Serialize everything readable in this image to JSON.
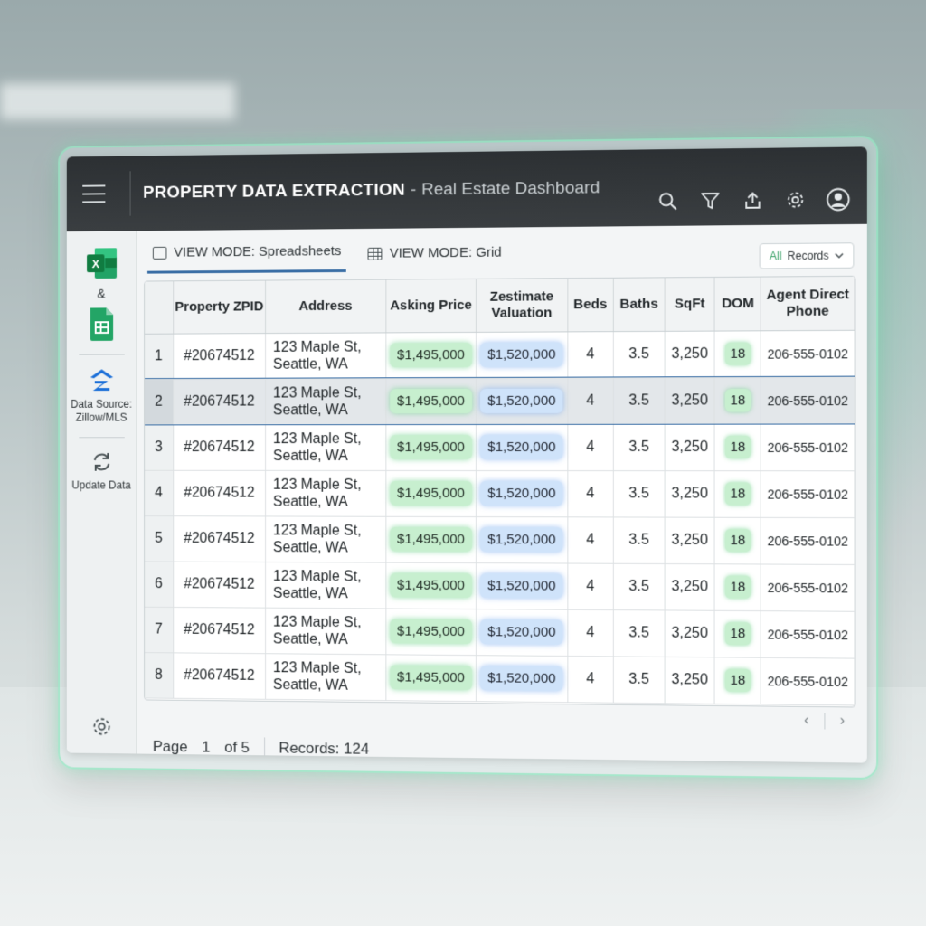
{
  "window": {
    "title_main": "PROPERTY DATA EXTRACTION",
    "title_dash": "-",
    "title_sub": "Real Estate Dashboard"
  },
  "toolbar_icons": [
    "search-icon",
    "filter-icon",
    "share-icon",
    "settings-icon",
    "profile-icon"
  ],
  "sidebar": {
    "ampersand": "&",
    "data_source_label": "Data Source: Zillow/MLS",
    "update_label": "Update Data"
  },
  "tabs": [
    {
      "label": "VIEW MODE: Spreadsheets",
      "active": true
    },
    {
      "label": "VIEW MODE: Grid",
      "active": false
    }
  ],
  "filter": {
    "all": "All",
    "label": "Records"
  },
  "table": {
    "headers": {
      "zpid": "Property ZPID",
      "address": "Address",
      "asking": "Asking Price",
      "zestimate": "Zestimate Valuation",
      "beds": "Beds",
      "baths": "Baths",
      "sqft": "SqFt",
      "dom": "DOM",
      "phone": "Agent Direct Phone"
    },
    "rows": [
      {
        "n": "1",
        "zpid": "#20674512",
        "addr1": "123 Maple St,",
        "addr2": "Seattle, WA",
        "asking": "$1,495,000",
        "zestimate": "$1,520,000",
        "beds": "4",
        "baths": "3.5",
        "sqft": "3,250",
        "dom": "18",
        "phone": "206-555-0102"
      },
      {
        "n": "2",
        "zpid": "#20674512",
        "addr1": "123 Maple St,",
        "addr2": "Seattle, WA",
        "asking": "$1,495,000",
        "zestimate": "$1,520,000",
        "beds": "4",
        "baths": "3.5",
        "sqft": "3,250",
        "dom": "18",
        "phone": "206-555-0102"
      },
      {
        "n": "3",
        "zpid": "#20674512",
        "addr1": "123 Maple St,",
        "addr2": "Seattle, WA",
        "asking": "$1,495,000",
        "zestimate": "$1,520,000",
        "beds": "4",
        "baths": "3.5",
        "sqft": "3,250",
        "dom": "18",
        "phone": "206-555-0102"
      },
      {
        "n": "4",
        "zpid": "#20674512",
        "addr1": "123 Maple St,",
        "addr2": "Seattle, WA",
        "asking": "$1,495,000",
        "zestimate": "$1,520,000",
        "beds": "4",
        "baths": "3.5",
        "sqft": "3,250",
        "dom": "18",
        "phone": "206-555-0102"
      },
      {
        "n": "5",
        "zpid": "#20674512",
        "addr1": "123 Maple St,",
        "addr2": "Seattle, WA",
        "asking": "$1,495,000",
        "zestimate": "$1,520,000",
        "beds": "4",
        "baths": "3.5",
        "sqft": "3,250",
        "dom": "18",
        "phone": "206-555-0102"
      },
      {
        "n": "6",
        "zpid": "#20674512",
        "addr1": "123 Maple St,",
        "addr2": "Seattle, WA",
        "asking": "$1,495,000",
        "zestimate": "$1,520,000",
        "beds": "4",
        "baths": "3.5",
        "sqft": "3,250",
        "dom": "18",
        "phone": "206-555-0102"
      },
      {
        "n": "7",
        "zpid": "#20674512",
        "addr1": "123 Maple St,",
        "addr2": "Seattle, WA",
        "asking": "$1,495,000",
        "zestimate": "$1,520,000",
        "beds": "4",
        "baths": "3.5",
        "sqft": "3,250",
        "dom": "18",
        "phone": "206-555-0102"
      },
      {
        "n": "8",
        "zpid": "#20674512",
        "addr1": "123 Maple St,",
        "addr2": "Seattle, WA",
        "asking": "$1,495,000",
        "zestimate": "$1,520,000",
        "beds": "4",
        "baths": "3.5",
        "sqft": "3,250",
        "dom": "18",
        "phone": "206-555-0102"
      }
    ],
    "selected_row": "2"
  },
  "pager": {
    "prev": "‹",
    "next": "›"
  },
  "footer": {
    "page_label": "Page",
    "page_num": "1",
    "of_label": "of 5",
    "records": "Records: 124"
  },
  "colors": {
    "accent_blue": "#3a6ea5",
    "green_pill": "#c7efcf",
    "blue_pill": "#cfe3fa",
    "titlebar": "#2c3033"
  }
}
